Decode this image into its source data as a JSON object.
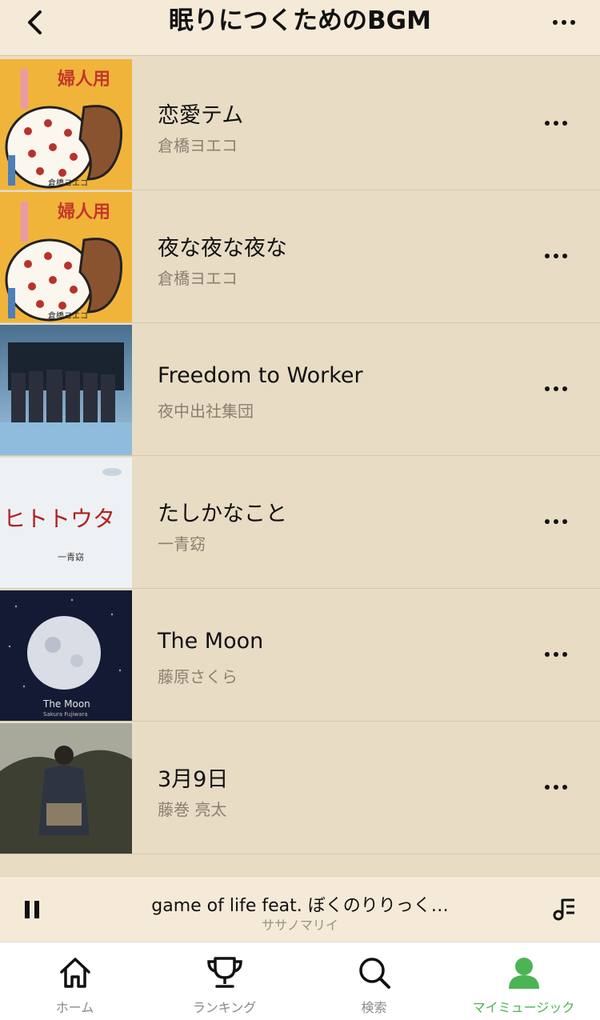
{
  "header": {
    "title": "眠りにつくためのBGM",
    "back_icon": "chevron-left-icon",
    "more_icon": "more-horizontal-icon"
  },
  "tracks": [
    {
      "title": "恋愛テム",
      "artist": "倉橋ヨエコ",
      "art_text": "婦人用",
      "art_sub": "倉橋ヨエコ"
    },
    {
      "title": "夜な夜な夜な",
      "artist": "倉橋ヨエコ",
      "art_text": "婦人用",
      "art_sub": "倉橋ヨエコ"
    },
    {
      "title": "Freedom to Worker",
      "artist": "夜中出社集団"
    },
    {
      "title": "たしかなこと",
      "artist": "一青窈",
      "art_text": "ヒトトウタ",
      "art_sub": "一青窈"
    },
    {
      "title": "The Moon",
      "artist": "藤原さくら",
      "art_text": "The Moon",
      "art_sub": "Sakura Fujiwara"
    },
    {
      "title": "3月9日",
      "artist": "藤巻 亮太"
    }
  ],
  "player": {
    "now_title": "game of life feat. ぼくのりりっく…",
    "now_artist": "ササノマリイ",
    "pause_icon": "pause-icon",
    "queue_icon": "music-queue-icon"
  },
  "tabs": [
    {
      "label": "ホーム",
      "icon": "home-icon"
    },
    {
      "label": "ランキング",
      "icon": "trophy-icon"
    },
    {
      "label": "検索",
      "icon": "search-icon"
    },
    {
      "label": "マイミュージック",
      "icon": "person-icon",
      "active": true
    }
  ],
  "colors": {
    "accent": "#4bb455",
    "background": "#e8dcc5",
    "header": "#f4ead7"
  }
}
